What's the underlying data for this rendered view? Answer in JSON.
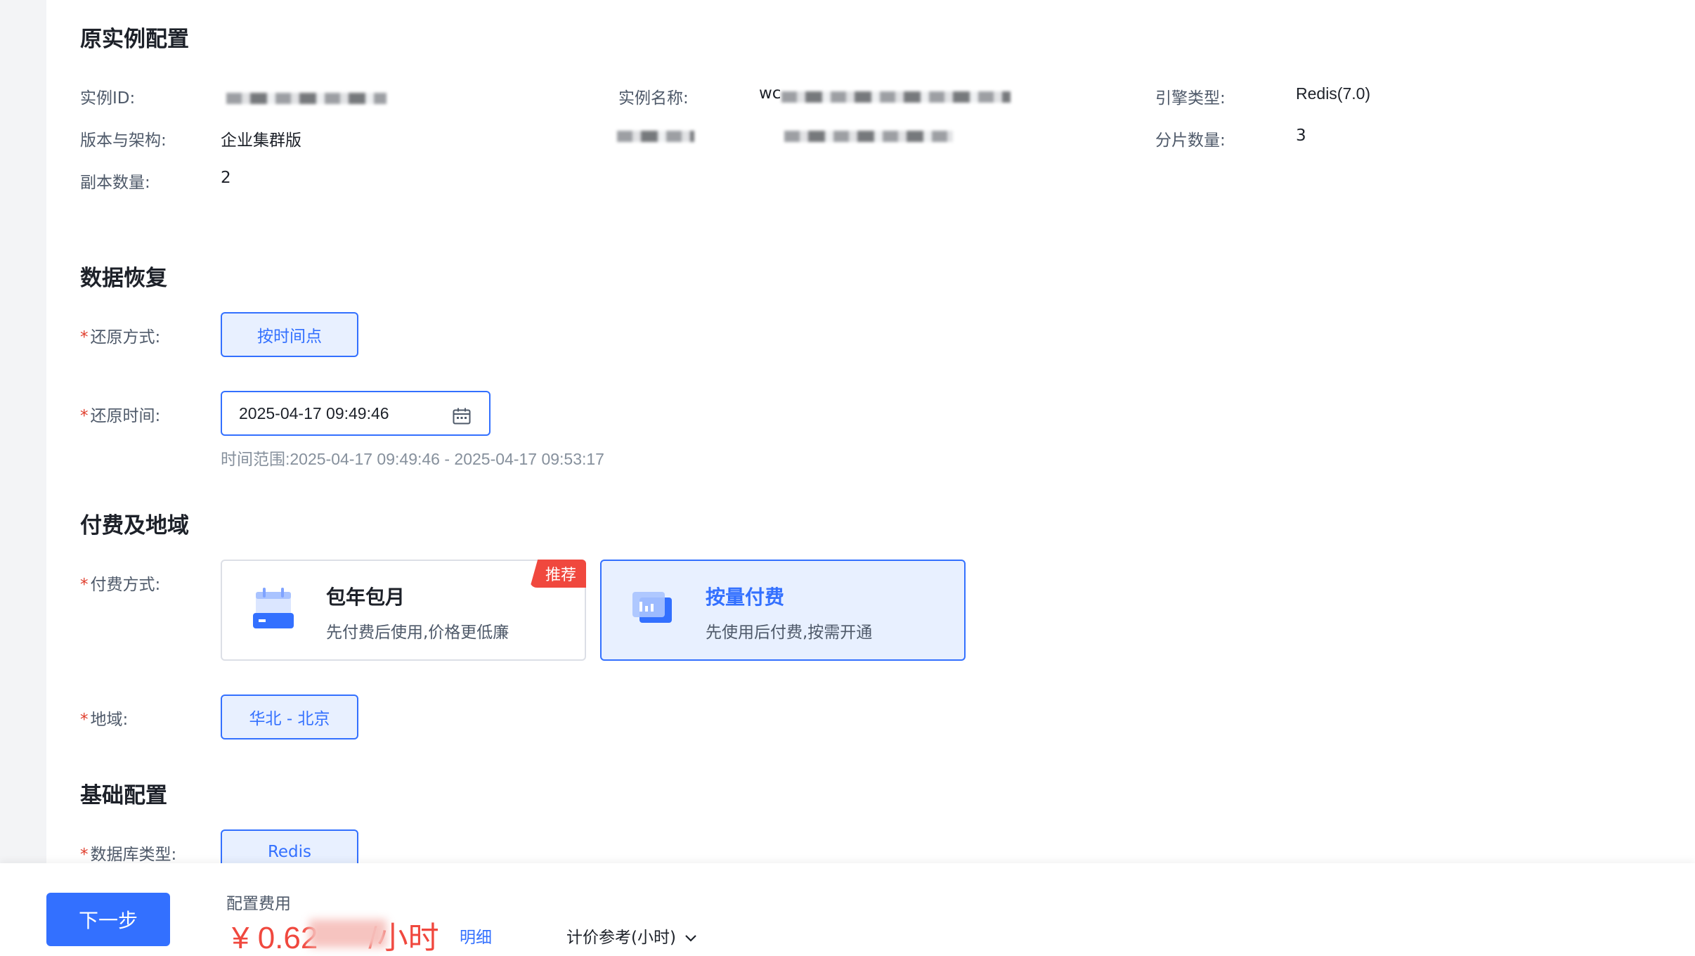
{
  "original_config": {
    "section_title": "原实例配置",
    "instance_id_label": "实例ID:",
    "instance_name_label": "实例名称:",
    "instance_name_visible": "wc",
    "engine_type_label": "引擎类型:",
    "engine_type_value": "Redis(7.0)",
    "version_label": "版本与架构:",
    "version_value": "企业集群版",
    "shard_count_label": "分片数量:",
    "shard_count_value": "3",
    "replica_count_label": "副本数量:",
    "replica_count_value": "2"
  },
  "data_recovery": {
    "section_title": "数据恢复",
    "restore_method_label": "还原方式:",
    "restore_method_value": "按时间点",
    "restore_time_label": "还原时间:",
    "restore_time_value": "2025-04-17 09:49:46",
    "time_range_hint": "时间范围:2025-04-17 09:49:46 - 2025-04-17 09:53:17"
  },
  "billing_region": {
    "section_title": "付费及地域",
    "payment_label": "付费方式:",
    "payment_options": [
      {
        "title": "包年包月",
        "desc": "先付费后使用,价格更低廉",
        "badge": "推荐",
        "selected": false
      },
      {
        "title": "按量付费",
        "desc": "先使用后付费,按需开通",
        "selected": true
      }
    ],
    "region_label": "地域:",
    "region_value": "华北 - 北京"
  },
  "basic_config": {
    "section_title": "基础配置",
    "db_type_label": "数据库类型:",
    "db_type_value": "Redis"
  },
  "footer": {
    "next_button": "下一步",
    "fee_label": "配置费用",
    "fee_amount_prefix": "¥ 0.62",
    "fee_amount_suffix": "/小时",
    "detail_link": "明细",
    "price_reference": "计价参考(小时)"
  },
  "colors": {
    "primary": "#3370ff",
    "danger": "#f0483e",
    "selected_bg": "#e8f0ff"
  },
  "icons": {
    "calendar": "calendar-icon",
    "annual_plan": "annual-plan-icon",
    "pay_as_you_go": "pay-as-you-go-icon",
    "chevron": "chevron-down-icon"
  }
}
